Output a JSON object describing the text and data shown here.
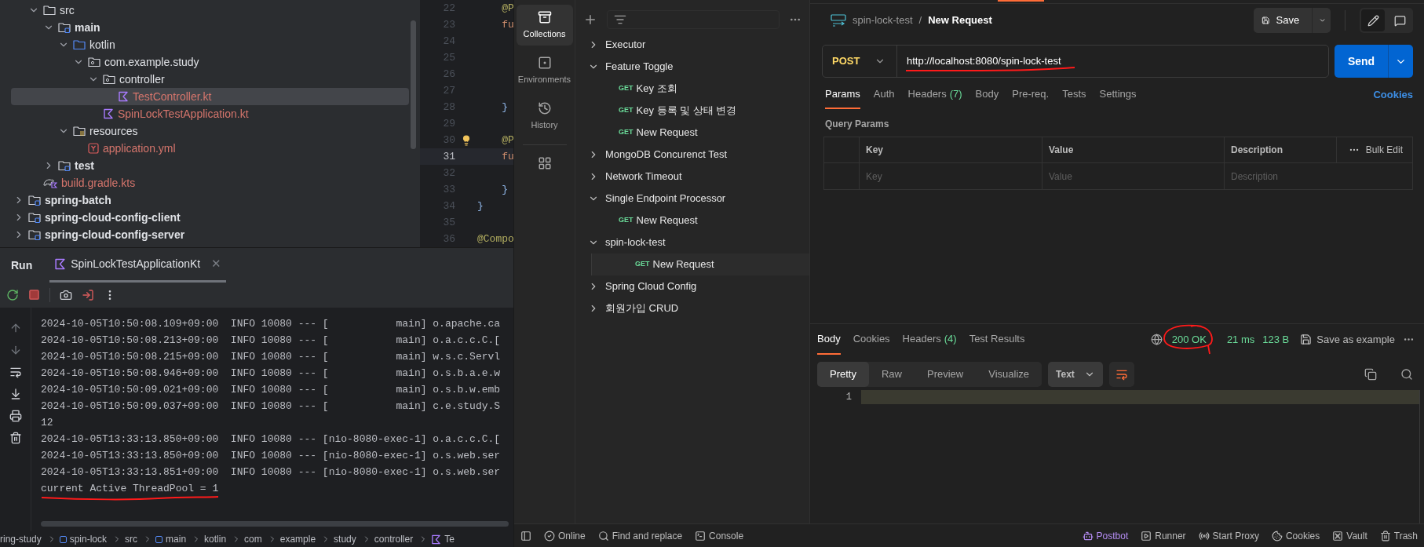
{
  "ide": {
    "project_tree": [
      {
        "children": [
          {
            "label": "src",
            "kind": "folder",
            "expanded": true,
            "selected": false,
            "untracked": false,
            "children": [
              {
                "label": "main",
                "kind": "source_set",
                "expanded": true,
                "selected": false,
                "untracked": false,
                "children": [
                  {
                    "label": "kotlin",
                    "kind": "source_root",
                    "expanded": true,
                    "selected": false,
                    "untracked": false,
                    "children": [
                      {
                        "label": "com.example.study",
                        "kind": "package",
                        "expanded": true,
                        "selected": false,
                        "untracked": false,
                        "children": [
                          {
                            "label": "controller",
                            "kind": "package",
                            "expanded": true,
                            "selected": false,
                            "untracked": false,
                            "children": [
                              {
                                "label": "TestController.kt",
                                "kind": "kotlin_file",
                                "selected": true,
                                "untracked": true
                              }
                            ]
                          },
                          {
                            "label": "SpinLockTestApplication.kt",
                            "kind": "kotlin_file",
                            "selected": false,
                            "untracked": true
                          }
                        ]
                      }
                    ]
                  },
                  {
                    "label": "resources",
                    "kind": "resources",
                    "expanded": true,
                    "selected": false,
                    "untracked": false,
                    "children": [
                      {
                        "label": "application.yml",
                        "kind": "yaml_file",
                        "selected": false,
                        "untracked": true
                      }
                    ]
                  }
                ]
              },
              {
                "label": "test",
                "kind": "source_set",
                "expanded": false,
                "selected": false,
                "untracked": false
              }
            ]
          },
          {
            "label": "build.gradle.kts",
            "kind": "gradle_file",
            "selected": false,
            "untracked": true
          }
        ]
      },
      {
        "label": "spring-batch",
        "kind": "module",
        "expanded": false,
        "selected": false,
        "untracked": false
      },
      {
        "label": "spring-cloud-config-client",
        "kind": "module",
        "expanded": false,
        "selected": false,
        "untracked": false
      },
      {
        "label": "spring-cloud-config-server",
        "kind": "module",
        "expanded": false,
        "selected": false,
        "untracked": false
      }
    ],
    "editor": {
      "lines": [
        {
          "number": "22",
          "code": "    @P",
          "kind": "annotation",
          "selected": false,
          "bulb": false
        },
        {
          "number": "23",
          "code": "    fu",
          "kind": "keyword",
          "selected": false,
          "bulb": false
        },
        {
          "number": "24",
          "selected": false,
          "bulb": false
        },
        {
          "number": "25",
          "selected": false,
          "bulb": false
        },
        {
          "number": "26",
          "selected": false,
          "bulb": false
        },
        {
          "number": "27",
          "selected": false,
          "bulb": false
        },
        {
          "number": "28",
          "code": "    }",
          "kind": "brace",
          "selected": false,
          "bulb": false
        },
        {
          "number": "29",
          "selected": false,
          "bulb": false
        },
        {
          "number": "30",
          "code": "    @P",
          "kind": "annotation",
          "selected": false,
          "bulb": true
        },
        {
          "number": "31",
          "code": "    fu",
          "kind": "keyword",
          "selected": true,
          "bulb": false
        },
        {
          "number": "32",
          "selected": false,
          "bulb": false
        },
        {
          "number": "33",
          "code": "    }",
          "kind": "brace",
          "selected": false,
          "bulb": false
        },
        {
          "number": "34",
          "code": "}",
          "kind": "brace",
          "selected": false,
          "bulb": false
        },
        {
          "number": "35",
          "selected": false,
          "bulb": false
        },
        {
          "number": "36",
          "code": "@Compo",
          "kind": "annotation",
          "selected": false,
          "bulb": false
        }
      ]
    },
    "run": {
      "title": "Run",
      "tabs": [
        {
          "label": "SpinLockTestApplicationKt",
          "close": "✕",
          "selected": true
        }
      ],
      "log": [
        "2024-10-05T10:50:08.109+09:00  INFO 10080 --- [           main] o.apache.ca",
        "2024-10-05T10:50:08.213+09:00  INFO 10080 --- [           main] o.a.c.c.C.[",
        "2024-10-05T10:50:08.215+09:00  INFO 10080 --- [           main] w.s.c.Servl",
        "2024-10-05T10:50:08.946+09:00  INFO 10080 --- [           main] o.s.b.a.e.w",
        "2024-10-05T10:50:09.021+09:00  INFO 10080 --- [           main] o.s.b.w.emb",
        "2024-10-05T10:50:09.037+09:00  INFO 10080 --- [           main] c.e.study.S",
        "12",
        "2024-10-05T13:33:13.850+09:00  INFO 10080 --- [nio-8080-exec-1] o.a.c.c.C.[",
        "2024-10-05T13:33:13.850+09:00  INFO 10080 --- [nio-8080-exec-1] o.s.web.ser",
        "2024-10-05T13:33:13.851+09:00  INFO 10080 --- [nio-8080-exec-1] o.s.web.ser",
        "current Active ThreadPool = 1"
      ]
    },
    "breadcrumb": [
      {
        "label": "ring-study",
        "kind": "folder"
      },
      {
        "label": "spin-lock",
        "kind": "module"
      },
      {
        "label": "src",
        "kind": "folder"
      },
      {
        "label": "main",
        "kind": "module"
      },
      {
        "label": "kotlin",
        "kind": "folder"
      },
      {
        "label": "com",
        "kind": "folder"
      },
      {
        "label": "example",
        "kind": "folder"
      },
      {
        "label": "study",
        "kind": "folder"
      },
      {
        "label": "controller",
        "kind": "folder"
      },
      {
        "label": "Te",
        "kind": "kotlin_file"
      }
    ]
  },
  "postman": {
    "rail": [
      {
        "label": "Collections",
        "kind": "collections",
        "selected": true
      },
      {
        "label": "Environments",
        "kind": "environments",
        "selected": false
      },
      {
        "label": "History",
        "kind": "history",
        "selected": false
      }
    ],
    "collections": [
      {
        "label": "Executor",
        "expanded": false
      },
      {
        "label": "Feature Toggle",
        "expanded": true,
        "children": [
          {
            "method": "GET",
            "label": "Key 조회",
            "selected": false
          },
          {
            "method": "GET",
            "label": "Key 등록 및 상태 변경",
            "selected": false
          },
          {
            "method": "GET",
            "label": "New Request",
            "selected": false
          }
        ]
      },
      {
        "label": "MongoDB Concurenct Test",
        "expanded": false
      },
      {
        "label": "Network Timeout",
        "expanded": false
      },
      {
        "label": "Single Endpoint Processor",
        "expanded": true,
        "children": [
          {
            "method": "GET",
            "label": "New Request",
            "selected": false
          }
        ]
      },
      {
        "label": "spin-lock-test",
        "expanded": true,
        "children": [
          {
            "method": "GET",
            "label": "New Request",
            "selected": true
          }
        ]
      },
      {
        "label": "Spring Cloud Config",
        "expanded": false
      },
      {
        "label": "회원가입 CRUD",
        "expanded": false
      }
    ],
    "view_modes": [
      {
        "kind": "edit",
        "selected": true
      },
      {
        "kind": "comments",
        "selected": false
      }
    ],
    "request": {
      "collection": "spin-lock-test",
      "separator": "/",
      "name": "New Request",
      "save": "Save",
      "method": "POST",
      "url": "http://localhost:8080/spin-lock-test",
      "send": "Send",
      "tabs": [
        {
          "label": "Params",
          "selected": true
        },
        {
          "label": "Auth",
          "selected": false
        },
        {
          "label": "Headers",
          "count": "(7)",
          "selected": false
        },
        {
          "label": "Body",
          "selected": false
        },
        {
          "label": "Pre-req.",
          "selected": false
        },
        {
          "label": "Tests",
          "selected": false
        },
        {
          "label": "Settings",
          "selected": false
        }
      ],
      "cookies": "Cookies",
      "section_title": "Query Params",
      "columns": [
        "Key",
        "Value",
        "Description"
      ],
      "bulk_edit": "Bulk Edit",
      "placeholders": [
        "Key",
        "Value",
        "Description"
      ]
    },
    "response": {
      "tabs": [
        {
          "label": "Body",
          "selected": true
        },
        {
          "label": "Cookies",
          "selected": false
        },
        {
          "label": "Headers",
          "count": "(4)",
          "selected": false
        },
        {
          "label": "Test Results",
          "selected": false
        }
      ],
      "status": "200 OK",
      "time": "21 ms",
      "size": "123 B",
      "save_example": "Save as example",
      "views": [
        {
          "label": "Pretty",
          "selected": true
        },
        {
          "label": "Raw",
          "selected": false
        },
        {
          "label": "Preview",
          "selected": false
        },
        {
          "label": "Visualize",
          "selected": false
        }
      ],
      "format": "Text",
      "line_numbers": [
        "1"
      ]
    },
    "status_left": [
      {
        "label": "Online",
        "kind": "online"
      },
      {
        "label": "Find and replace",
        "kind": "find"
      },
      {
        "label": "Console",
        "kind": "console"
      }
    ],
    "status_right": [
      {
        "label": "Postbot",
        "kind": "postbot"
      },
      {
        "label": "Runner",
        "kind": "runner"
      },
      {
        "label": "Start Proxy",
        "kind": "proxy"
      },
      {
        "label": "Cookies",
        "kind": "cookies"
      },
      {
        "label": "Vault",
        "kind": "vault"
      },
      {
        "label": "Trash",
        "kind": "trash"
      }
    ]
  }
}
